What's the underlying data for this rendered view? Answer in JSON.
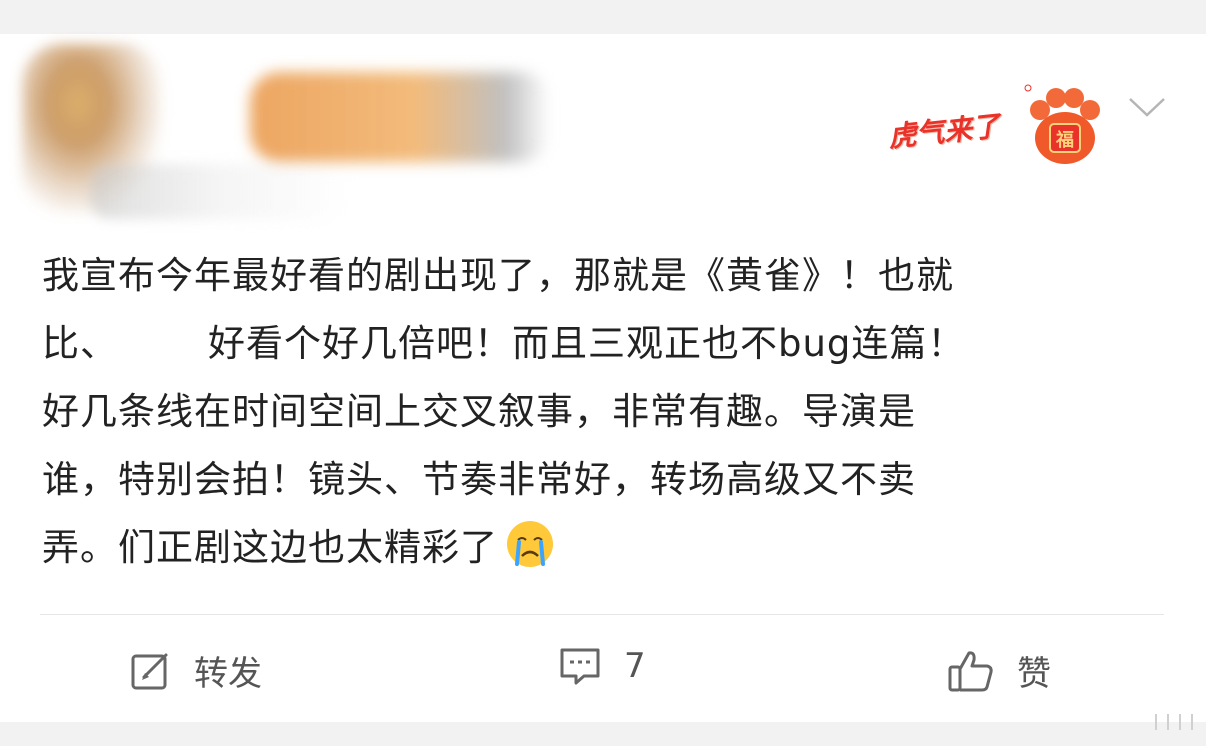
{
  "post": {
    "author": {
      "name_redacted": true
    },
    "badge_text": "虎气来了",
    "badge_symbol": "福",
    "lines": [
      "我宣布今年最好看的剧出现了，那就是《黄雀》！也就",
      [
        "比、",
        "好看个好几倍吧！而且三观正也不bug连篇！"
      ],
      "好几条线在时间空间上交叉叙事，非常有趣。导演是",
      "谁，特别会拍！镜头、节奏非常好，转场高级又不卖",
      "弄。们正剧这边也太精彩了"
    ],
    "emoji": "crying-face-emoji"
  },
  "actions": {
    "repost_label": "转发",
    "comment_count": "7",
    "like_label": "赞"
  },
  "colors": {
    "text": "#222222",
    "action_gray": "#555555",
    "badge_red": "#e8322a",
    "background": "#f2f2f2"
  }
}
